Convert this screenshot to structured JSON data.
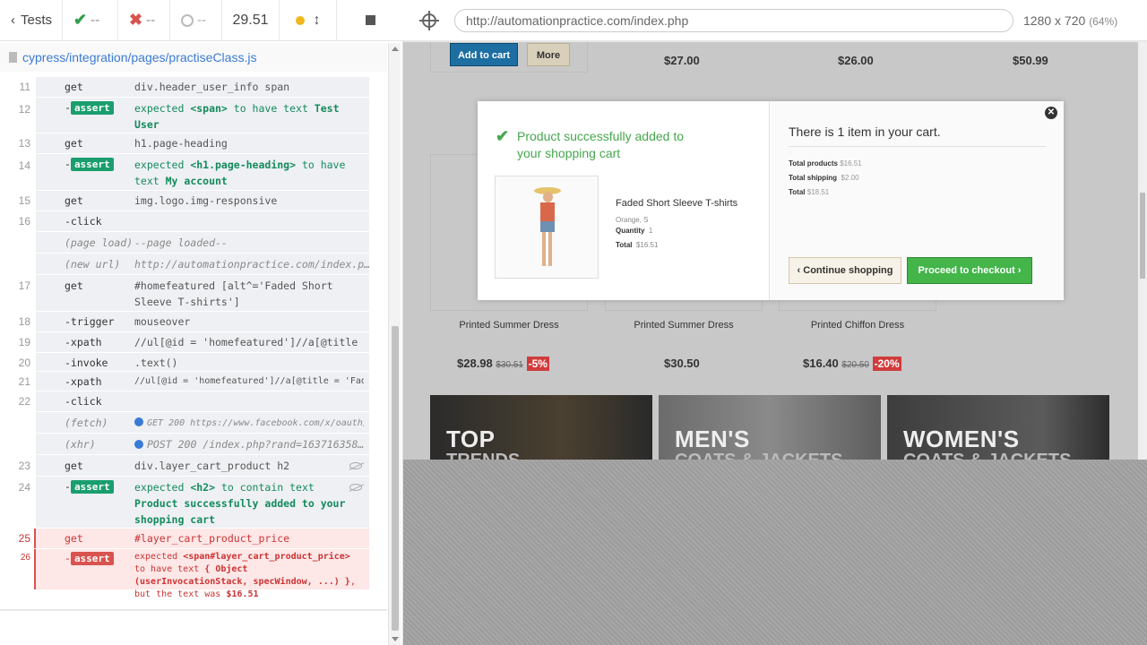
{
  "runner": {
    "tests_label": "Tests",
    "passed": "--",
    "failed": "--",
    "pending": "--",
    "duration": "29.51",
    "spec_path": "cypress/integration/pages/practiseClass.js"
  },
  "commands": [
    {
      "num": "11",
      "name": "get",
      "msg": "div.header_user_info span"
    },
    {
      "num": "12",
      "name": "-",
      "badge": "assert",
      "msg_pre": "expected ",
      "msg_a": "<span>",
      "msg_mid": " to have text ",
      "msg_b": "Test User"
    },
    {
      "num": "13",
      "name": "get",
      "msg": "h1.page-heading"
    },
    {
      "num": "14",
      "name": "-",
      "badge": "assert",
      "msg_pre": "expected ",
      "msg_a": "<h1.page-heading>",
      "msg_mid": " to have text ",
      "msg_b": "My account"
    },
    {
      "num": "15",
      "name": "get",
      "msg": "img.logo.img-responsive"
    },
    {
      "num": "16",
      "name": "-click",
      "msg": ""
    },
    {
      "num": "",
      "name": "(page load)",
      "msg": "--page loaded--"
    },
    {
      "num": "",
      "name": "(new url)",
      "msg": "http://automationpractice.com/index.p…"
    },
    {
      "num": "17",
      "name": "get",
      "msg": "#homefeatured [alt^='Faded Short Sleeve T-shirts']"
    },
    {
      "num": "18",
      "name": "-trigger",
      "msg": "mouseover"
    },
    {
      "num": "19",
      "name": "-xpath",
      "msg": "//ul[@id = 'homefeatured']//a[@title …"
    },
    {
      "num": "20",
      "name": "-invoke",
      "msg": ".text()"
    },
    {
      "num": "21",
      "name": "-xpath",
      "msg": "//ul[@id = 'homefeatured']//a[@title = 'Fade…"
    },
    {
      "num": "22",
      "name": "-click",
      "msg": ""
    },
    {
      "num": "",
      "name": "(fetch)",
      "msg": "GET 200 https://www.facebook.com/x/oauth/…"
    },
    {
      "num": "",
      "name": "(xhr)",
      "msg": "POST 200 /index.php?rand=163716358…"
    },
    {
      "num": "23",
      "name": "get",
      "msg": "div.layer_cart_product h2"
    },
    {
      "num": "24",
      "name": "-",
      "badge": "assert",
      "msg_pre": "expected ",
      "msg_a": "<h2>",
      "msg_mid": " to contain text ",
      "msg_b": "Product successfully added to your shopping cart"
    },
    {
      "num": "25",
      "name": "get",
      "msg": "#layer_cart_product_price"
    },
    {
      "num": "26",
      "name": "-",
      "badge": "assert",
      "msg_pre": "expected ",
      "msg_a": "<span#layer_cart_product_price>",
      "msg_mid": " to have text ",
      "msg_b": "{ Object (userInvocationStack, specWindow, ...) }",
      "msg_tail": ", but the text was ",
      "msg_c": "$16.51"
    }
  ],
  "aut": {
    "url": "http://automationpractice.com/index.php",
    "size": "1280 x 720",
    "scale": "(64%)"
  },
  "page": {
    "add_to_cart": "Add to cart",
    "more": "More",
    "top_prices": [
      "$27.00",
      "$26.00",
      "$50.99"
    ],
    "products": [
      {
        "name": "Printed Summer Dress",
        "price": "$28.98",
        "old": "$30.51",
        "disc": "-5%"
      },
      {
        "name": "Printed Summer Dress",
        "price": "$30.50"
      },
      {
        "name": "Printed Chiffon Dress",
        "price": "$16.40",
        "old": "$20.50",
        "disc": "-20%"
      }
    ],
    "banners": [
      {
        "t1": "TOP",
        "t2": "TRENDS"
      },
      {
        "t1": "MEN'S",
        "t2": "COATS & JACKETS"
      },
      {
        "t1": "WOMEN'S",
        "t2": "COATS & JACKETS"
      }
    ]
  },
  "modal": {
    "title": "Product successfully added to your shopping cart",
    "product_name": "Faded Short Sleeve T-shirts",
    "attributes": "Orange, S",
    "qty_label": "Quantity",
    "qty": "1",
    "total_label": "Total",
    "total": "$16.51",
    "cart_title": "There is 1 item in your cart.",
    "total_products_label": "Total products",
    "total_products": "$16.51",
    "total_shipping_label": "Total shipping",
    "total_shipping": "$2.00",
    "total_sum_label": "Total",
    "total_sum": "$18.51",
    "continue": "Continue shopping",
    "proceed": "Proceed to checkout"
  }
}
